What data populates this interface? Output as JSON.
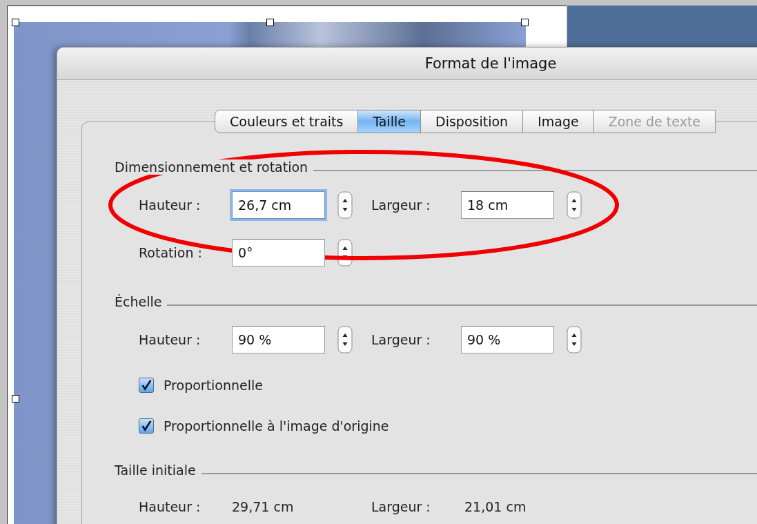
{
  "window": {
    "title": "Format de l'image"
  },
  "tabs": [
    {
      "label": "Couleurs et traits",
      "selected": false,
      "disabled": false
    },
    {
      "label": "Taille",
      "selected": true,
      "disabled": false
    },
    {
      "label": "Disposition",
      "selected": false,
      "disabled": false
    },
    {
      "label": "Image",
      "selected": false,
      "disabled": false
    },
    {
      "label": "Zone de texte",
      "selected": false,
      "disabled": true
    }
  ],
  "sections": [
    {
      "title": "Dimensionnement et rotation",
      "items": [
        {
          "kind": "fields",
          "fields": [
            {
              "label": "Hauteur :",
              "value": "26,7 cm",
              "focused": true
            },
            {
              "label": "Largeur :",
              "value": "18 cm",
              "focused": false
            }
          ]
        },
        {
          "kind": "fields",
          "fields": [
            {
              "label": "Rotation :",
              "value": "0°",
              "focused": false
            }
          ]
        }
      ]
    },
    {
      "title": "Échelle",
      "items": [
        {
          "kind": "fields",
          "fields": [
            {
              "label": "Hauteur :",
              "value": "90 %",
              "focused": false
            },
            {
              "label": "Largeur :",
              "value": "90 %",
              "focused": false
            }
          ]
        },
        {
          "kind": "checkbox",
          "label": "Proportionnelle",
          "checked": true
        },
        {
          "kind": "checkbox",
          "label": "Proportionnelle à l'image d'origine",
          "checked": true
        }
      ]
    },
    {
      "title": "Taille initiale",
      "items": [
        {
          "kind": "readouts",
          "fields": [
            {
              "label": "Hauteur :",
              "value": "29,71 cm"
            },
            {
              "label": "Largeur :",
              "value": "21,01 cm"
            }
          ]
        }
      ]
    }
  ]
}
